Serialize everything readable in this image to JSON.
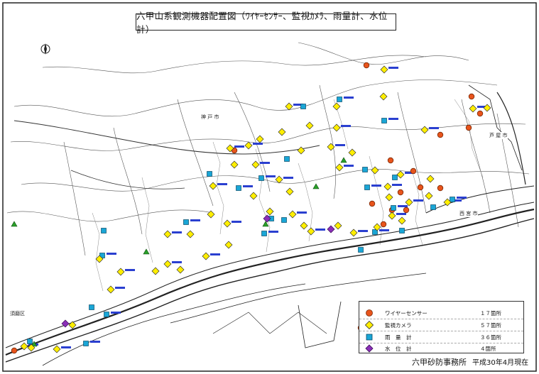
{
  "map": {
    "title": "六甲山系観測機器配置図（ﾜｲﾔｰｾﾝｻｰ、監視ｶﾒﾗ、雨量計、水位計）",
    "north_mark": "N",
    "cities": [
      {
        "name": "神 戸 市"
      },
      {
        "name": "西 宮 市"
      },
      {
        "name": "芦 屋 市"
      },
      {
        "name": "須磨区"
      }
    ],
    "colors": {
      "wire_sensor": "#e8541c",
      "camera": "#ffee00",
      "rain_gauge": "#1aa6d6",
      "water_level": "#8a2fb8",
      "site_label": "#2a3fd0",
      "road": "#222222"
    }
  },
  "legend": {
    "items": [
      {
        "name": "ワイヤーセンサー",
        "count": "１７箇所",
        "symbol": "orange-circle"
      },
      {
        "name": "監視カメラ",
        "count": "５７箇所",
        "symbol": "yellow-diamond"
      },
      {
        "name": "雨　量　計",
        "count": "３６箇所",
        "symbol": "cyan-square"
      },
      {
        "name": "水　位　計",
        "count": "４箇所",
        "symbol": "purple-diamond"
      }
    ]
  },
  "footer": {
    "office": "六甲砂防事務所",
    "as_of": "平成30年4月現在"
  }
}
